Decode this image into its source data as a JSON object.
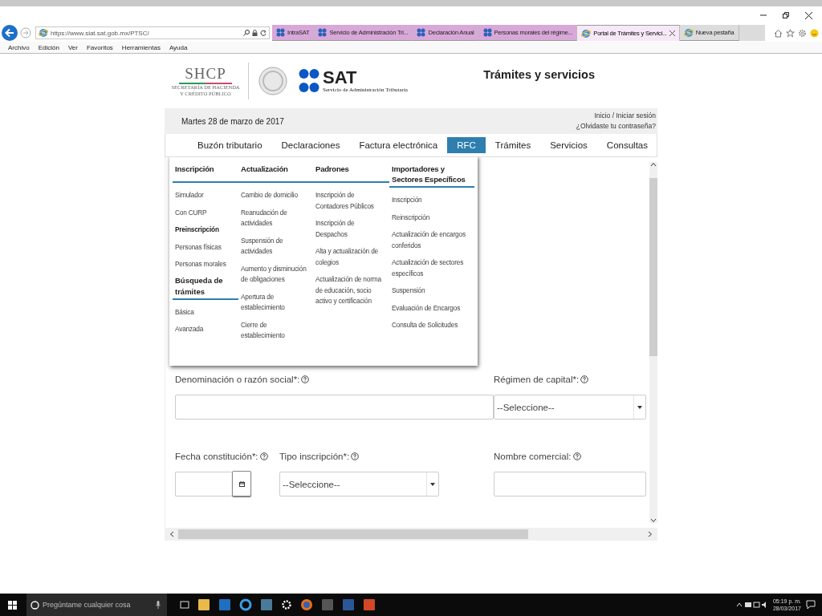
{
  "browser": {
    "address": "https://www.siat.sat.gob.mx/PTSC/",
    "tabs": [
      {
        "label": "IntraSAT",
        "kind": "sat",
        "color": "#d8a8d8",
        "selected": false
      },
      {
        "label": "Servicio de Administración Tri...",
        "kind": "sat",
        "color": "#d8a8d8",
        "selected": false
      },
      {
        "label": "Declaración Anual",
        "kind": "sat",
        "color": "#d8a8d8",
        "selected": false
      },
      {
        "label": "Personas morales del régime...",
        "kind": "sat",
        "color": "#d8a8d8",
        "selected": false
      },
      {
        "label": "Portal de Trámites y Servici...",
        "kind": "ie",
        "color": "#f7e8f7",
        "selected": true
      },
      {
        "label": "Nueva pestaña",
        "kind": "ie",
        "color": "#dcdcdc",
        "selected": false
      }
    ],
    "menu_bar": [
      "Archivo",
      "Edición",
      "Ver",
      "Favoritos",
      "Herramientas",
      "Ayuda"
    ]
  },
  "header": {
    "shcp": "SHCP",
    "shcp_subtitle": [
      "SECRETARÍA DE HACIENDA",
      "Y CRÉDITO PÚBLICO"
    ],
    "sat": "SAT",
    "sat_subtitle": "Servicio de Administración Tributaria",
    "title": "Trámites y servicios"
  },
  "info_bar": {
    "date": "Martes 28 de marzo de 2017",
    "login_link": "Inicio / Iniciar sesión",
    "forgot_link": "¿Olvidaste tu contraseña?"
  },
  "nav": [
    {
      "label": "Buzón tributario",
      "selected": false
    },
    {
      "label": "Declaraciones",
      "selected": false
    },
    {
      "label": "Factura electrónica",
      "selected": false
    },
    {
      "label": "RFC",
      "selected": true
    },
    {
      "label": "Trámites",
      "selected": false
    },
    {
      "label": "Servicios",
      "selected": false
    },
    {
      "label": "Consultas",
      "selected": false
    }
  ],
  "mega_menu": [
    {
      "heading": "Inscripción",
      "items": [
        {
          "label": "Simulador",
          "kind": "link"
        },
        {
          "label": "Con CURP",
          "kind": "link"
        },
        {
          "label": "Preinscripción",
          "kind": "label"
        },
        {
          "label": "Personas físicas",
          "kind": "link"
        },
        {
          "label": "Personas morales",
          "kind": "link"
        },
        {
          "label": "Búsqueda de trámites",
          "kind": "heading"
        },
        {
          "label": "Básica",
          "kind": "link"
        },
        {
          "label": "Avanzada",
          "kind": "link"
        }
      ]
    },
    {
      "heading": "Actualización",
      "items": [
        {
          "label": "Cambio de domicilio",
          "kind": "link"
        },
        {
          "label": "Reanudación de actividades",
          "kind": "link"
        },
        {
          "label": "Suspensión de actividades",
          "kind": "link"
        },
        {
          "label": "Aumento y disminución de obligaciones",
          "kind": "link"
        },
        {
          "label": "Apertura de establecimiento",
          "kind": "link"
        },
        {
          "label": "Cierre de establecimiento",
          "kind": "link"
        }
      ]
    },
    {
      "heading": "Padrones",
      "items": [
        {
          "label": "Inscripción de Contadores Públicos",
          "kind": "link"
        },
        {
          "label": "Inscripción de Despachos",
          "kind": "link"
        },
        {
          "label": "Alta y actualización de colegios",
          "kind": "link"
        },
        {
          "label": "Actualización de norma de educación, socio activo y certificación",
          "kind": "link"
        }
      ]
    },
    {
      "heading": "Importadores y Sectores Específicos",
      "items": [
        {
          "label": "Inscripción",
          "kind": "link"
        },
        {
          "label": "Reinscripción",
          "kind": "link"
        },
        {
          "label": "Actualización de encargos conferidos",
          "kind": "link"
        },
        {
          "label": "Actualización de sectores específicos",
          "kind": "link"
        },
        {
          "label": "Suspensión",
          "kind": "link"
        },
        {
          "label": "Evaluación de Encargos",
          "kind": "link"
        },
        {
          "label": "Consulta de Solicitudes",
          "kind": "link"
        }
      ]
    }
  ],
  "form": {
    "rows": [
      [
        {
          "label": "Denominación o razón social*:",
          "kind": "text"
        },
        "",
        {
          "label": "Régimen de capital*:",
          "kind": "select",
          "value": "--Seleccione--"
        }
      ],
      [
        {
          "label": "Fecha constitución*:",
          "kind": "date"
        },
        {
          "label": "Tipo inscripción*:",
          "kind": "select",
          "value": "--Seleccione--"
        },
        {
          "label": "Nombre comercial:",
          "kind": "text"
        }
      ]
    ]
  },
  "taskbar": {
    "search_placeholder": "Pregúntame cualquier cosa",
    "time": "05:19 p. m.",
    "date": "28/03/2017"
  }
}
